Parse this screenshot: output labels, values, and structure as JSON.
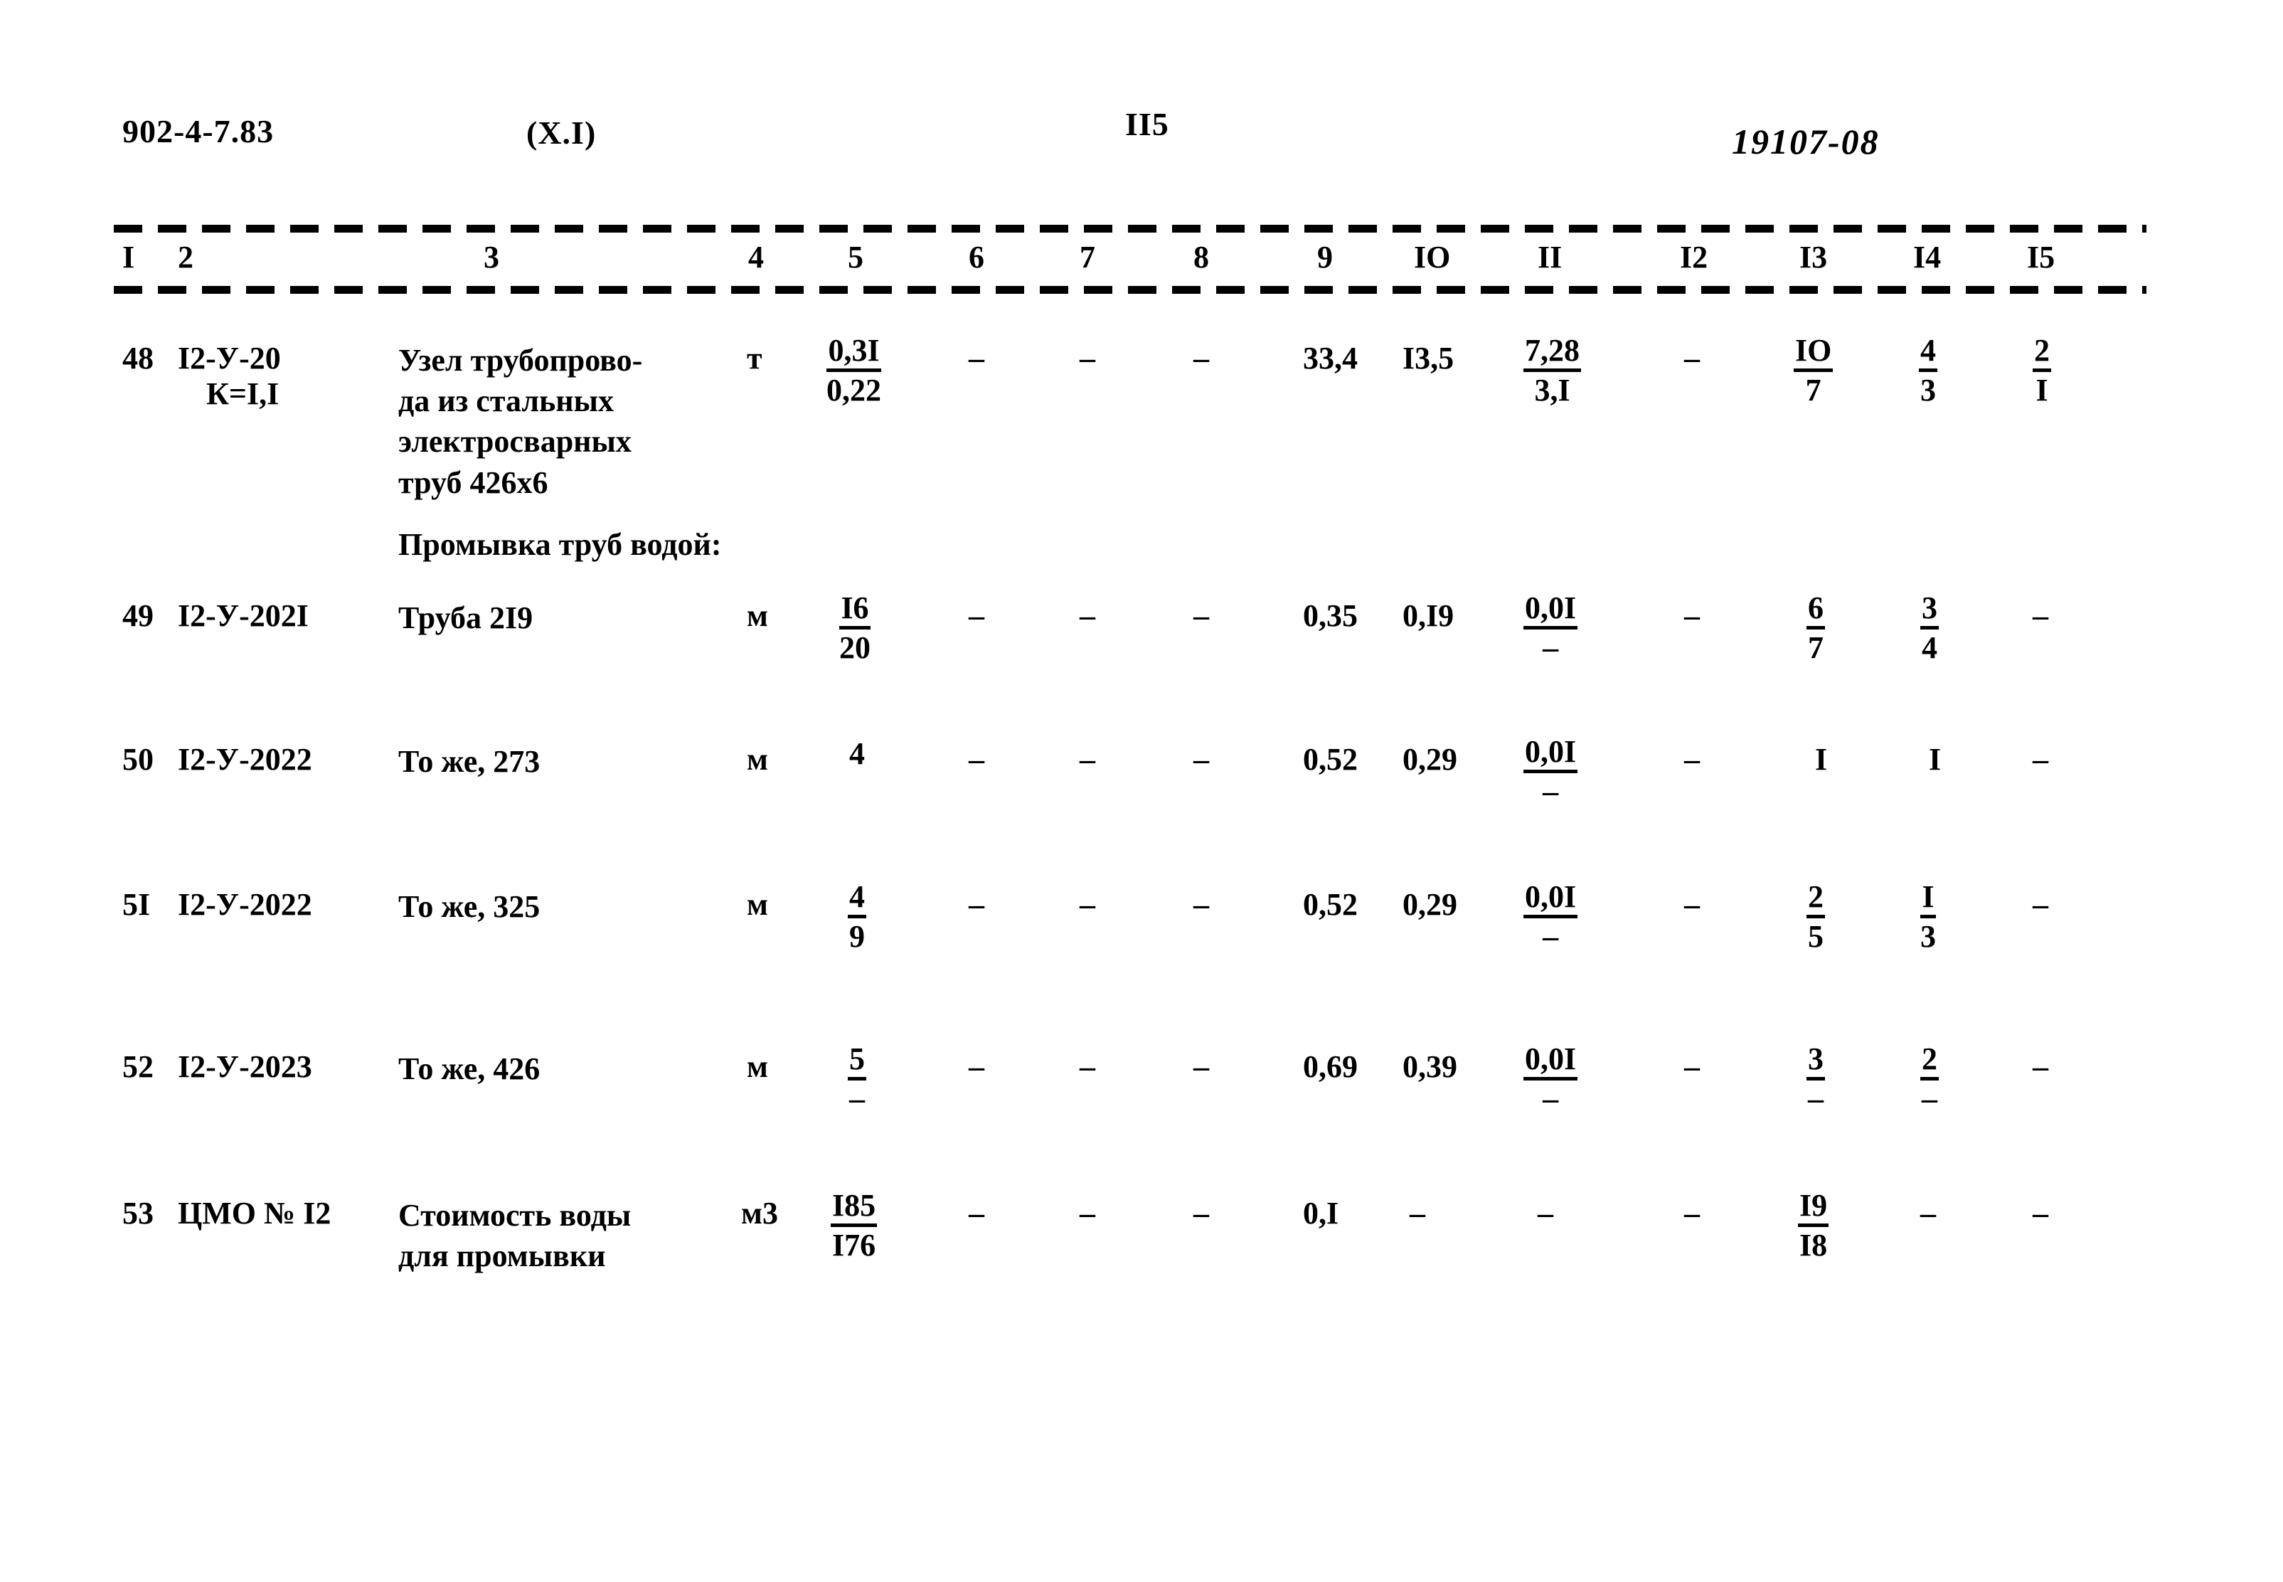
{
  "header": {
    "doc_code": "902-4-7.83",
    "section_code": "(X.I)",
    "page_number": "II5",
    "stamp_code": "19107-08"
  },
  "table": {
    "column_headers": [
      "I",
      "2",
      "3",
      "4",
      "5",
      "6",
      "7",
      "8",
      "9",
      "IO",
      "II",
      "I2",
      "I3",
      "I4",
      "I5"
    ],
    "section_labels": [
      {
        "text": "Промывка труб водой:"
      }
    ],
    "rows": [
      {
        "num": "48",
        "code": "I2-У-20",
        "code2": "К=I,I",
        "name": "Узел трубопрово-\nда из стальных\nэлектросварных\nтруб 426х6",
        "unit": "т",
        "c5_num": "0,3I",
        "c5_den": "0,22",
        "c6": "–",
        "c7": "–",
        "c8": "–",
        "c9": "33,4",
        "c10": "I3,5",
        "c11_num": "7,28",
        "c11_den": "3,I",
        "c12": "–",
        "c13_num": "IO",
        "c13_den": "7",
        "c14_num": "4",
        "c14_den": "3",
        "c15_num": "2",
        "c15_den": "I"
      },
      {
        "num": "49",
        "code": "I2-У-202I",
        "code2": "",
        "name": "Труба 2I9",
        "unit": "м",
        "c5_num": "I6",
        "c5_den": "20",
        "c6": "–",
        "c7": "–",
        "c8": "–",
        "c9": "0,35",
        "c10": "0,I9",
        "c11_num": "0,0I",
        "c11_den": "–",
        "c12": "–",
        "c13_num": "6",
        "c13_den": "7",
        "c14_num": "3",
        "c14_den": "4",
        "c15_num": "–",
        "c15_den": ""
      },
      {
        "num": "50",
        "code": "I2-У-2022",
        "code2": "",
        "name": "То же, 273",
        "unit": "м",
        "c5_num": "4",
        "c5_den": "",
        "c6": "–",
        "c7": "–",
        "c8": "–",
        "c9": "0,52",
        "c10": "0,29",
        "c11_num": "0,0I",
        "c11_den": "–",
        "c12": "–",
        "c13_num": "I",
        "c13_den": "",
        "c14_num": "I",
        "c14_den": "",
        "c15_num": "–",
        "c15_den": ""
      },
      {
        "num": "5I",
        "code": "I2-У-2022",
        "code2": "",
        "name": "То же, 325",
        "unit": "м",
        "c5_num": "4",
        "c5_den": "9",
        "c6": "–",
        "c7": "–",
        "c8": "–",
        "c9": "0,52",
        "c10": "0,29",
        "c11_num": "0,0I",
        "c11_den": "–",
        "c12": "–",
        "c13_num": "2",
        "c13_den": "5",
        "c14_num": "I",
        "c14_den": "3",
        "c15_num": "–",
        "c15_den": ""
      },
      {
        "num": "52",
        "code": "I2-У-2023",
        "code2": "",
        "name": "То же, 426",
        "unit": "м",
        "c5_num": "5",
        "c5_den": "–",
        "c6": "–",
        "c7": "–",
        "c8": "–",
        "c9": "0,69",
        "c10": "0,39",
        "c11_num": "0,0I",
        "c11_den": "–",
        "c12": "–",
        "c13_num": "3",
        "c13_den": "–",
        "c14_num": "2",
        "c14_den": "–",
        "c15_num": "–",
        "c15_den": ""
      },
      {
        "num": "53",
        "code": "ЦМО № I2",
        "code2": "",
        "name": "Стоимость воды\nдля промывки",
        "unit": "м3",
        "c5_num": "I85",
        "c5_den": "I76",
        "c6": "–",
        "c7": "–",
        "c8": "–",
        "c9": "0,I",
        "c10": "–",
        "c11_num": "–",
        "c11_den": "",
        "c12": "–",
        "c13_num": "I9",
        "c13_den": "I8",
        "c14_num": "–",
        "c14_den": "",
        "c15_num": "–",
        "c15_den": ""
      }
    ]
  }
}
